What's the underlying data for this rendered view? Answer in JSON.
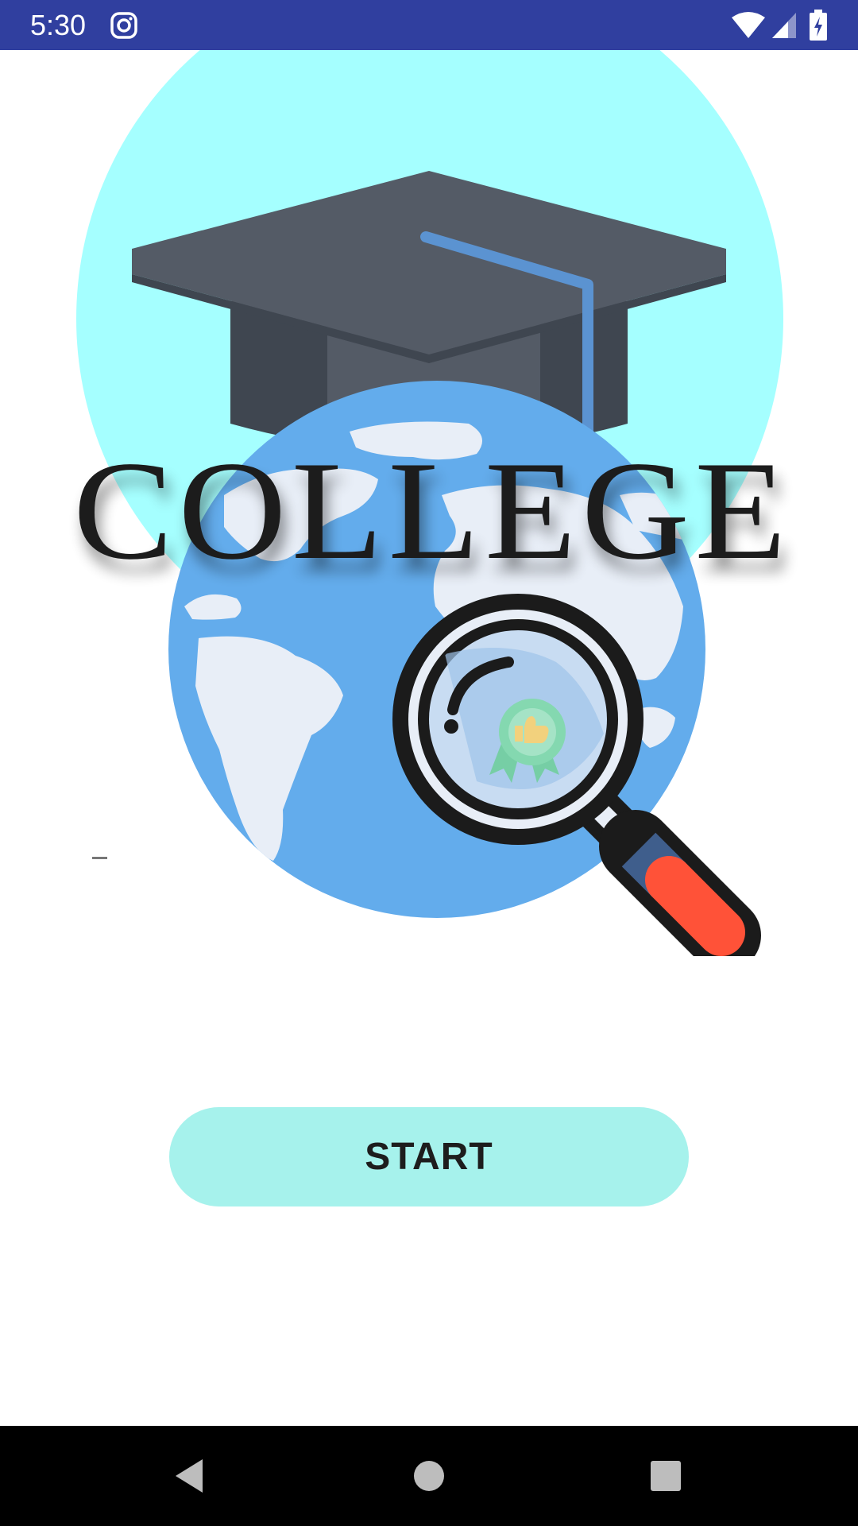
{
  "status_bar": {
    "time": "5:30",
    "background_color": "#303f9f",
    "icons": [
      "instagram-icon",
      "wifi-icon",
      "cellular-signal-icon",
      "battery-charging-icon"
    ]
  },
  "splash": {
    "title": "COLLEGE",
    "illustration": [
      "graduation-cap-icon",
      "globe-icon",
      "magnifying-glass-icon",
      "award-badge-icon"
    ],
    "colors": {
      "sky_circle": "#a5ffff",
      "globe": "#63acec",
      "cap": "#545b66",
      "magnifier_handle": "#ff5238"
    }
  },
  "start_button": {
    "label": "START",
    "color": "#a6f2ec"
  },
  "nav_bar": {
    "icons": [
      "back-icon",
      "home-icon",
      "recents-icon"
    ]
  }
}
